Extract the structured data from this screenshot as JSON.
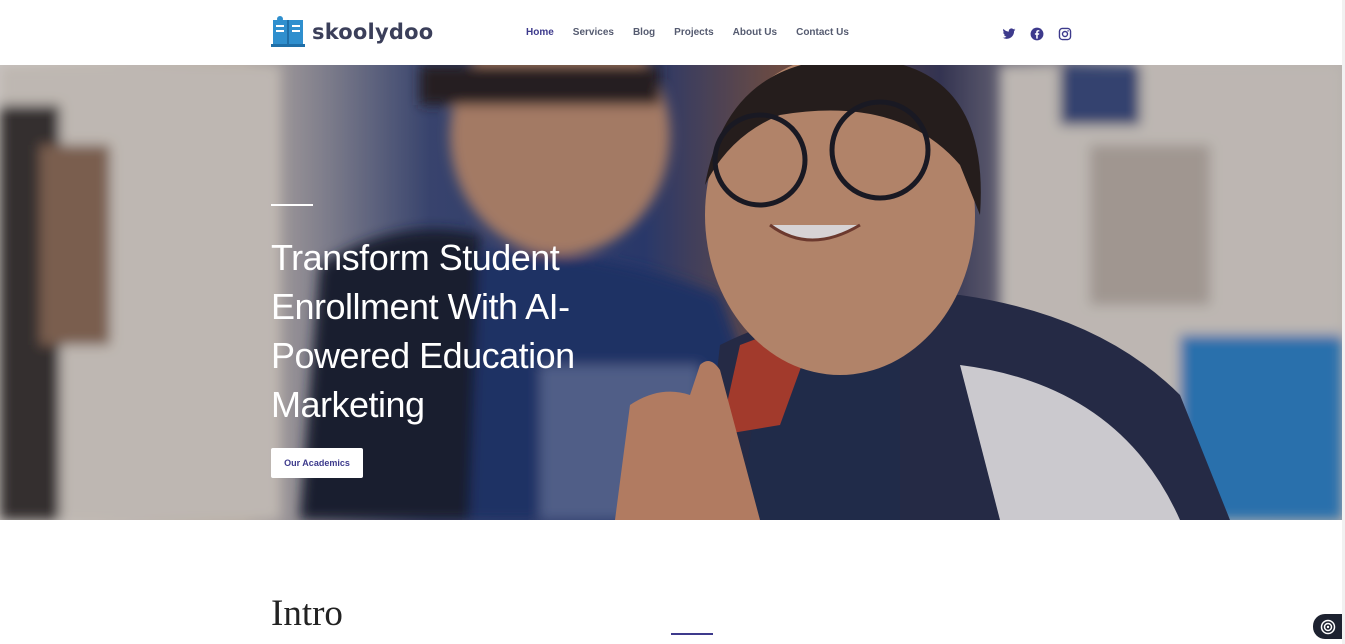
{
  "brand": {
    "name": "skoolydoo"
  },
  "nav": {
    "items": [
      {
        "label": "Home",
        "active": true
      },
      {
        "label": "Services"
      },
      {
        "label": "Blog"
      },
      {
        "label": "Projects"
      },
      {
        "label": "About Us"
      },
      {
        "label": "Contact Us"
      }
    ]
  },
  "social": [
    "twitter-icon",
    "facebook-icon",
    "instagram-icon"
  ],
  "hero": {
    "title": "Transform Student Enrollment With AI-Powered Education Marketing",
    "cta_label": "Our Academics"
  },
  "intro": {
    "title": "Intro"
  },
  "colors": {
    "accent": "#3d3a8c",
    "logo_blue": "#2f8fce",
    "text_dark": "#3b3f5a"
  }
}
